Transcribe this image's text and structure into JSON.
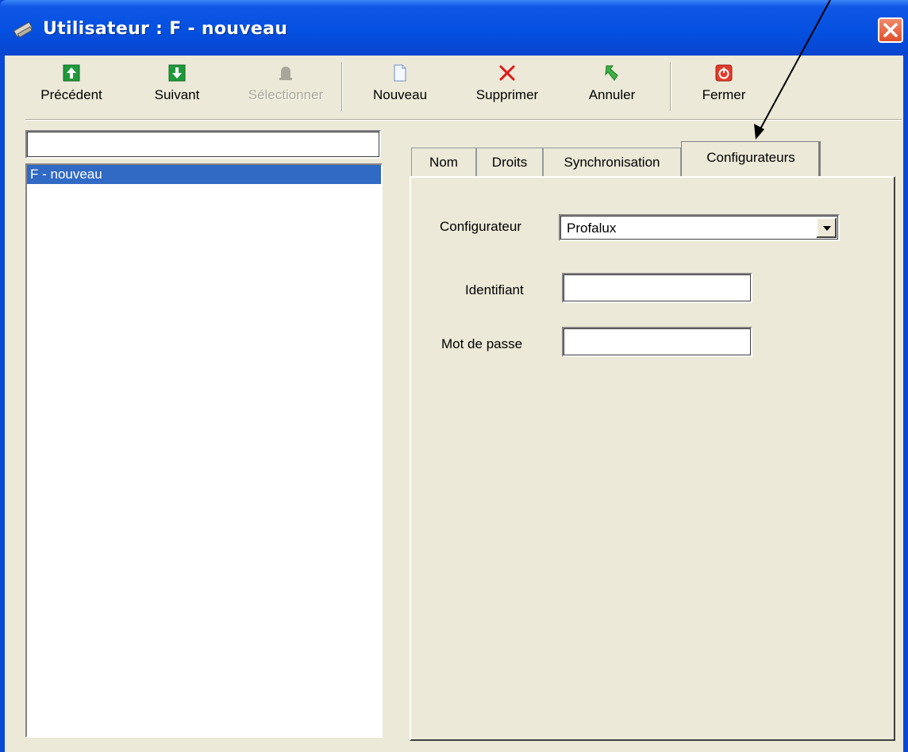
{
  "window": {
    "title": "Utilisateur : F - nouveau"
  },
  "toolbar": {
    "buttons": [
      {
        "label": "Précédent",
        "icon": "arrow-up-icon",
        "enabled": true
      },
      {
        "label": "Suivant",
        "icon": "arrow-down-icon",
        "enabled": true
      },
      {
        "label": "Sélectionner",
        "icon": "bell-icon",
        "enabled": false
      },
      {
        "label": "Nouveau",
        "icon": "new-document-icon",
        "enabled": true
      },
      {
        "label": "Supprimer",
        "icon": "delete-x-icon",
        "enabled": true
      },
      {
        "label": "Annuler",
        "icon": "undo-arrow-icon",
        "enabled": true
      },
      {
        "label": "Fermer",
        "icon": "power-icon",
        "enabled": true
      }
    ]
  },
  "search": {
    "value": ""
  },
  "user_list": {
    "items": [
      "F - nouveau"
    ],
    "selected_index": 0
  },
  "tabs": [
    {
      "label": "Nom"
    },
    {
      "label": "Droits"
    },
    {
      "label": "Synchronisation"
    },
    {
      "label": "Configurateurs",
      "active": true
    }
  ],
  "form": {
    "configurateur_label": "Configurateur",
    "configurateur_value": "Profalux",
    "identifiant_label": "Identifiant",
    "identifiant_value": "",
    "mot_de_passe_label": "Mot de passe",
    "mot_de_passe_value": ""
  },
  "colors": {
    "title_bar": "#0450e0",
    "client_bg": "#ece9d8",
    "selection": "#316ac5",
    "close_button": "#e0502d"
  }
}
